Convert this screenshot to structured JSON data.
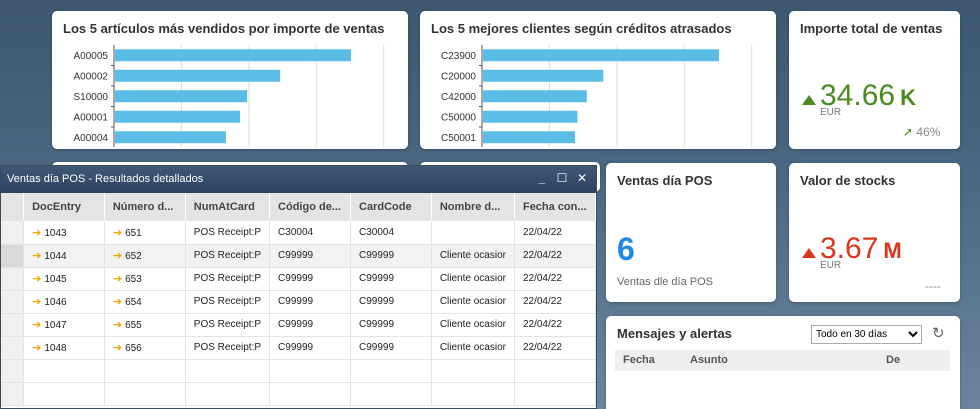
{
  "cards": {
    "top_items": {
      "title": "Los 5 artículos más vendidos por importe de ventas",
      "chart_data": {
        "type": "bar",
        "orientation": "horizontal",
        "categories": [
          "A00005",
          "A00002",
          "S10000",
          "A00001",
          "A00004"
        ],
        "values": [
          100,
          70,
          56,
          53,
          47
        ],
        "color": "#5bbde6",
        "grid": true
      }
    },
    "top_customers": {
      "title": "Los 5 mejores clientes según créditos atrasados",
      "chart_data": {
        "type": "bar",
        "orientation": "horizontal",
        "categories": [
          "C23900",
          "C20000",
          "C42000",
          "C50000",
          "C50001"
        ],
        "values": [
          100,
          51,
          44,
          40,
          39
        ],
        "color": "#5bbde6",
        "grid": true
      }
    },
    "total_sales": {
      "title": "Importe total de ventas",
      "value": "34.66",
      "unit": "K",
      "currency": "EUR",
      "change": "46%",
      "color": "#4a8c1c"
    },
    "pos_sales": {
      "title": "Ventas día POS",
      "value": "6",
      "caption": "Ventas dle día POS",
      "color": "#1e88e5"
    },
    "stock_value": {
      "title": "Valor de stocks",
      "value": "3.67",
      "unit": "M",
      "currency": "EUR",
      "change": "----",
      "color": "#d9361b"
    },
    "messages": {
      "title": "Mensajes y alertas",
      "filter": "Todo en 30 días",
      "columns": [
        "Fecha",
        "Asunto",
        "De"
      ]
    }
  },
  "window": {
    "title": "Ventas día POS - Resultados detallados",
    "buttons": {
      "minimize": "_",
      "maximize": "☐",
      "close": "✕"
    },
    "columns": [
      "DocEntry",
      "Número d...",
      "NumAtCard",
      "Código de...",
      "CardCode",
      "Nombre d...",
      "Fecha con..."
    ],
    "rows": [
      [
        "1043",
        "651",
        "POS Receipt:P",
        "C30004",
        "C30004",
        "",
        "22/04/22"
      ],
      [
        "1044",
        "652",
        "POS Receipt:P",
        "C99999",
        "C99999",
        "Cliente ocasior",
        "22/04/22"
      ],
      [
        "1045",
        "653",
        "POS Receipt:P",
        "C99999",
        "C99999",
        "Cliente ocasior",
        "22/04/22"
      ],
      [
        "1046",
        "654",
        "POS Receipt:P",
        "C99999",
        "C99999",
        "Cliente ocasior",
        "22/04/22"
      ],
      [
        "1047",
        "655",
        "POS Receipt:P",
        "C99999",
        "C99999",
        "Cliente ocasior",
        "22/04/22"
      ],
      [
        "1048",
        "656",
        "POS Receipt:P",
        "C99999",
        "C99999",
        "Cliente ocasior",
        "22/04/22"
      ]
    ],
    "selected_row": 1,
    "link_arrow": "➔"
  }
}
